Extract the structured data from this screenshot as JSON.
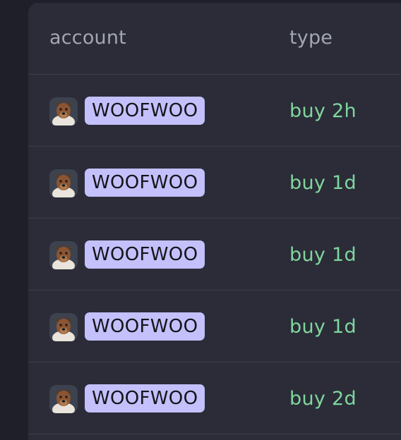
{
  "table": {
    "headers": {
      "account": "account",
      "type": "type"
    },
    "rows": [
      {
        "account": "WOOFWOO",
        "type": "buy 2h",
        "avatar_icon": "dog-avatar-icon"
      },
      {
        "account": "WOOFWOO",
        "type": "buy 1d",
        "avatar_icon": "dog-avatar-icon"
      },
      {
        "account": "WOOFWOO",
        "type": "buy 1d",
        "avatar_icon": "dog-avatar-icon"
      },
      {
        "account": "WOOFWOO",
        "type": "buy 1d",
        "avatar_icon": "dog-avatar-icon"
      },
      {
        "account": "WOOFWOO",
        "type": "buy 2d",
        "avatar_icon": "dog-avatar-icon"
      }
    ]
  },
  "colors": {
    "background": "#1e1f28",
    "panel": "#2b2c37",
    "header_text": "#a3a6b3",
    "tag_bg": "#c3c0fb",
    "buy_text": "#7fd69f",
    "divider": "#3a3c4b"
  }
}
